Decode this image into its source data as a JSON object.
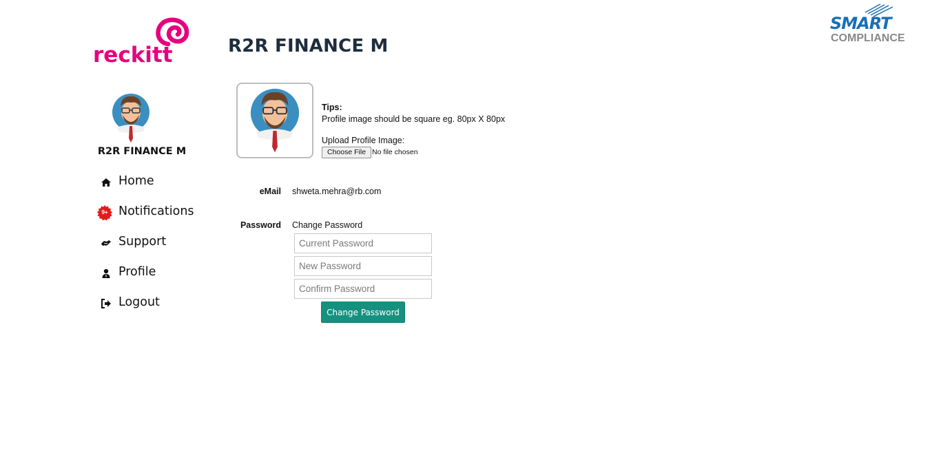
{
  "brand": {
    "company_logo_text": "reckitt",
    "vendor_logo_line1": "SMART",
    "vendor_logo_line2": "COMPLIANCE",
    "accent_pink": "#e6007e",
    "vendor_blue": "#1a6fb5"
  },
  "page": {
    "title": "R2R FINANCE M"
  },
  "sidebar": {
    "username": "R2R FINANCE M",
    "items": [
      {
        "label": "Home",
        "icon": "home-icon"
      },
      {
        "label": "Notifications",
        "icon": "notification-badge-icon",
        "badge": "9+"
      },
      {
        "label": "Support",
        "icon": "handshake-icon"
      },
      {
        "label": "Profile",
        "icon": "user-icon"
      },
      {
        "label": "Logout",
        "icon": "logout-icon"
      }
    ]
  },
  "profile_image": {
    "tips_title": "Tips:",
    "tips_text": "Profile image should be square eg. 80px X 80px",
    "upload_label": "Upload Profile Image:",
    "choose_file_label": "Choose File",
    "no_file_text": "No file chosen"
  },
  "email": {
    "label": "eMail",
    "value": "shweta.mehra@rb.com"
  },
  "password": {
    "label": "Password",
    "section_title": "Change Password",
    "current_placeholder": "Current Password",
    "new_placeholder": "New Password",
    "confirm_placeholder": "Confirm Password",
    "submit_label": "Change Password",
    "button_color": "#16917f"
  }
}
